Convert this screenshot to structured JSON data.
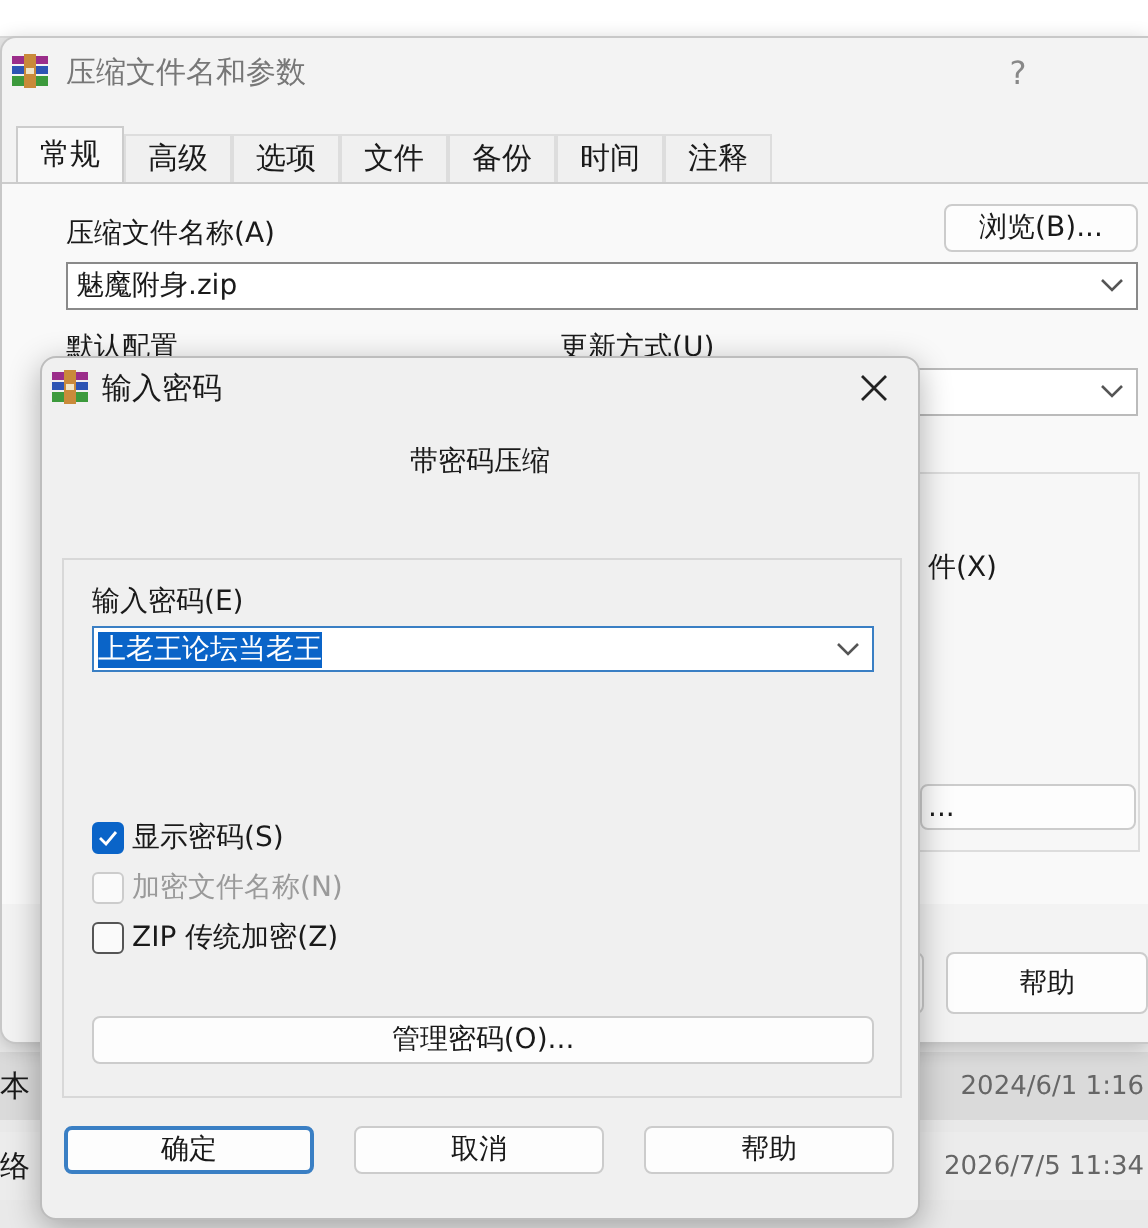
{
  "explorer": {
    "rows": [
      {
        "column_1": "本",
        "column_2": "2024/6/1 1:16",
        "selected": true
      },
      {
        "column_1": "络",
        "column_2": "2026/7/5 11:34",
        "selected": false
      }
    ]
  },
  "archive_dialog": {
    "title": "压缩文件名和参数",
    "help_button": "?",
    "tabs": [
      {
        "label": "常规",
        "selected": true
      },
      {
        "label": "高级",
        "selected": false
      },
      {
        "label": "选项",
        "selected": false
      },
      {
        "label": "文件",
        "selected": false
      },
      {
        "label": "备份",
        "selected": false
      },
      {
        "label": "时间",
        "selected": false
      },
      {
        "label": "注释",
        "selected": false
      }
    ],
    "archive_name_label": "压缩文件名称(A)",
    "browse_button": "浏览(B)...",
    "archive_name": "魅魔附身.zip",
    "profile_label": "默认配置",
    "update_mode_label": "更新方式(U)",
    "option_text": "件(X)",
    "option_button": "...",
    "help_button_bottom": "帮助"
  },
  "password_dialog": {
    "title": "输入密码",
    "heading": "带密码压缩",
    "password_label": "输入密码(E)",
    "password": "上老王论坛当老王",
    "options": [
      {
        "label": "显示密码(S)",
        "checked": true,
        "disabled": false
      },
      {
        "label": "加密文件名称(N)",
        "checked": false,
        "disabled": true
      },
      {
        "label": "ZIP 传统加密(Z)",
        "checked": false,
        "disabled": false
      }
    ],
    "manage_button": "管理密码(O)...",
    "buttons": [
      {
        "label": "确定",
        "default": true
      },
      {
        "label": "取消",
        "default": false
      },
      {
        "label": "帮助",
        "default": false
      }
    ]
  }
}
